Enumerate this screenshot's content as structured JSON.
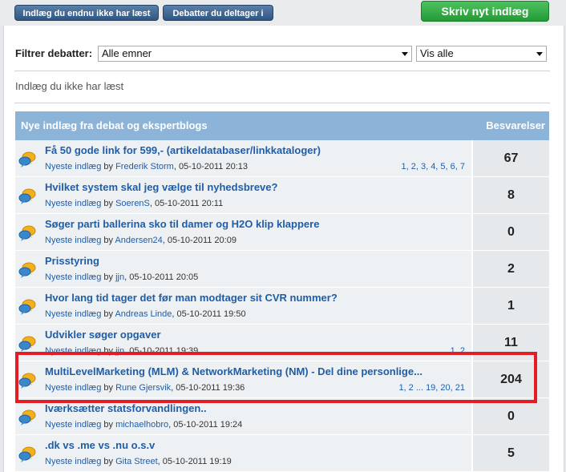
{
  "toolbar": {
    "unread_label": "Indlæg du endnu ikke har læst",
    "participating_label": "Debatter du deltager i",
    "new_post_label": "Skriv nyt indlæg"
  },
  "filter": {
    "label": "Filtrer debatter:",
    "topic_value": "Alle emner",
    "show_value": "Vis alle"
  },
  "section_heading": "Indlæg du ikke har læst",
  "table": {
    "col_title": "Nye indlæg fra debat og ekspertblogs",
    "col_replies": "Besvarelser",
    "rows": [
      {
        "title": "Få 50 gode link for 599,- (artikeldatabaser/linkkataloger)",
        "latest": "Nyeste indlæg",
        "by": "by",
        "author": "Frederik Storm",
        "date": ", 05-10-2011 20:13",
        "pages": "1, 2, 3, 4, 5, 6, 7",
        "replies": "67"
      },
      {
        "title": "Hvilket system skal jeg vælge til nyhedsbreve?",
        "latest": "Nyeste indlæg",
        "by": "by",
        "author": "SoerenS",
        "date": ", 05-10-2011 20:11",
        "pages": "",
        "replies": "8"
      },
      {
        "title": "Søger parti ballerina sko til damer og H2O klip klappere",
        "latest": "Nyeste indlæg",
        "by": "by",
        "author": "Andersen24",
        "date": ", 05-10-2011 20:09",
        "pages": "",
        "replies": "0"
      },
      {
        "title": "Prisstyring",
        "latest": "Nyeste indlæg",
        "by": "by",
        "author": "jjn",
        "date": ", 05-10-2011 20:05",
        "pages": "",
        "replies": "2"
      },
      {
        "title": "Hvor lang tid tager det før man modtager sit CVR nummer?",
        "latest": "Nyeste indlæg",
        "by": "by",
        "author": "Andreas Linde",
        "date": ", 05-10-2011 19:50",
        "pages": "",
        "replies": "1"
      },
      {
        "title": "Udvikler søger opgaver",
        "latest": "Nyeste indlæg",
        "by": "by",
        "author": "jjn",
        "date": ", 05-10-2011 19:39",
        "pages": "1, 2",
        "replies": "11"
      },
      {
        "title": "MultiLevelMarketing (MLM) & NetworkMarketing (NM) - Del dine personlige...",
        "latest": "Nyeste indlæg",
        "by": "by",
        "author": "Rune Gjersvik",
        "date": ", 05-10-2011 19:36",
        "pages": "1, 2 ... 19, 20, 21",
        "replies": "204"
      },
      {
        "title": "Iværksætter statsforvandlingen..",
        "latest": "Nyeste indlæg",
        "by": "by",
        "author": "michaelhobro",
        "date": ", 05-10-2011 19:24",
        "pages": "",
        "replies": "0"
      },
      {
        "title": ".dk vs .me vs .nu o.s.v",
        "latest": "Nyeste indlæg",
        "by": "by",
        "author": "Gita Street",
        "date": ", 05-10-2011 19:19",
        "pages": "",
        "replies": "5"
      }
    ]
  },
  "colors": {
    "header_bg": "#8cb4d8",
    "link": "#1f5da8",
    "highlight": "#e21d26",
    "new_post_button": "#2fa842"
  },
  "icons": {
    "row_icon": "speech-bubbles-icon",
    "dropdown": "chevron-down-icon"
  }
}
